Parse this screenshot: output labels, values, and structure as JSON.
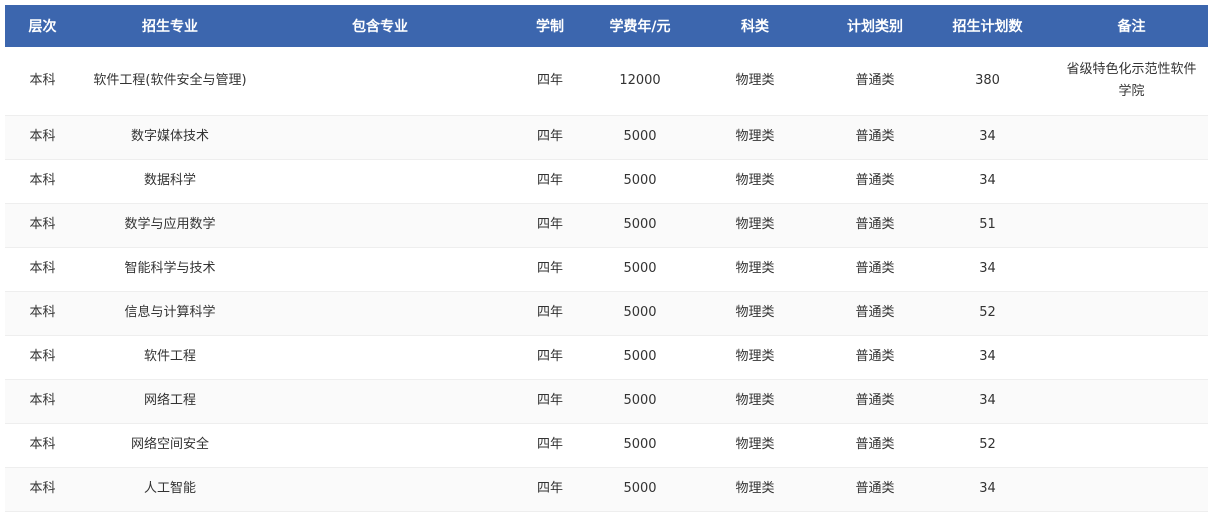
{
  "headers": {
    "level": "层次",
    "major": "招生专业",
    "included": "包含专业",
    "duration": "学制",
    "tuition": "学费年/元",
    "category": "科类",
    "plan_type": "计划类别",
    "plan_count": "招生计划数",
    "remark": "备注"
  },
  "rows": [
    {
      "level": "本科",
      "major": "软件工程(软件安全与管理)",
      "included": "",
      "duration": "四年",
      "tuition": "12000",
      "category": "物理类",
      "plan_type": "普通类",
      "plan_count": "380",
      "remark": "省级特色化示范性软件学院"
    },
    {
      "level": "本科",
      "major": "数字媒体技术",
      "included": "",
      "duration": "四年",
      "tuition": "5000",
      "category": "物理类",
      "plan_type": "普通类",
      "plan_count": "34",
      "remark": ""
    },
    {
      "level": "本科",
      "major": "数据科学",
      "included": "",
      "duration": "四年",
      "tuition": "5000",
      "category": "物理类",
      "plan_type": "普通类",
      "plan_count": "34",
      "remark": ""
    },
    {
      "level": "本科",
      "major": "数学与应用数学",
      "included": "",
      "duration": "四年",
      "tuition": "5000",
      "category": "物理类",
      "plan_type": "普通类",
      "plan_count": "51",
      "remark": ""
    },
    {
      "level": "本科",
      "major": "智能科学与技术",
      "included": "",
      "duration": "四年",
      "tuition": "5000",
      "category": "物理类",
      "plan_type": "普通类",
      "plan_count": "34",
      "remark": ""
    },
    {
      "level": "本科",
      "major": "信息与计算科学",
      "included": "",
      "duration": "四年",
      "tuition": "5000",
      "category": "物理类",
      "plan_type": "普通类",
      "plan_count": "52",
      "remark": ""
    },
    {
      "level": "本科",
      "major": "软件工程",
      "included": "",
      "duration": "四年",
      "tuition": "5000",
      "category": "物理类",
      "plan_type": "普通类",
      "plan_count": "34",
      "remark": ""
    },
    {
      "level": "本科",
      "major": "网络工程",
      "included": "",
      "duration": "四年",
      "tuition": "5000",
      "category": "物理类",
      "plan_type": "普通类",
      "plan_count": "34",
      "remark": ""
    },
    {
      "level": "本科",
      "major": "网络空间安全",
      "included": "",
      "duration": "四年",
      "tuition": "5000",
      "category": "物理类",
      "plan_type": "普通类",
      "plan_count": "52",
      "remark": ""
    },
    {
      "level": "本科",
      "major": "人工智能",
      "included": "",
      "duration": "四年",
      "tuition": "5000",
      "category": "物理类",
      "plan_type": "普通类",
      "plan_count": "34",
      "remark": ""
    }
  ]
}
